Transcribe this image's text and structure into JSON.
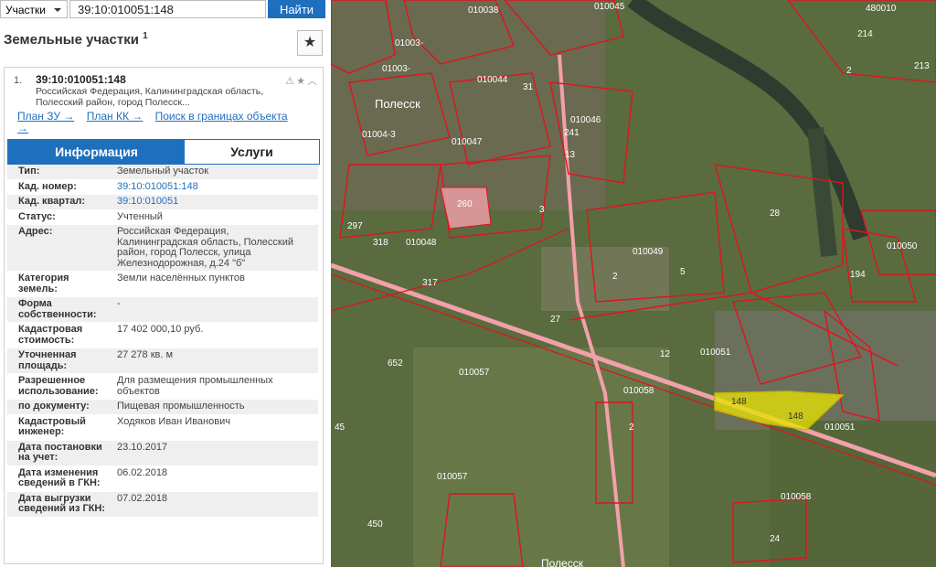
{
  "search": {
    "type_label": "Участки",
    "query": "39:10:010051:148",
    "button_label": "Найти"
  },
  "panel": {
    "title": "Земельные участки",
    "title_sup": "1"
  },
  "card": {
    "index": "1.",
    "cad_number": "39:10:010051:148",
    "address_short": "Российская Федерация, Калининградская область, Полесский район, город Полесск...",
    "links": [
      "План ЗУ →",
      "План КК →",
      "Поиск в границах объекта →"
    ],
    "tabs": [
      "Информация",
      "Услуги"
    ],
    "rows": [
      {
        "k": "Тип:",
        "v": "Земельный участок"
      },
      {
        "k": "Кад. номер:",
        "v": "39:10:010051:148"
      },
      {
        "k": "Кад. квартал:",
        "v": "39:10:010051"
      },
      {
        "k": "Статус:",
        "v": "Учтенный"
      },
      {
        "k": "Адрес:",
        "v": "Российская Федерация, Калининградская область, Полесский район, город Полесск, улица Железнодорожная, д.24 \"б\""
      },
      {
        "k": "Категория земель:",
        "v": "Земли населённых пунктов"
      },
      {
        "k": "Форма собственности:",
        "v": "-"
      },
      {
        "k": "Кадастровая стоимость:",
        "v": "17 402 000,10 руб."
      },
      {
        "k": "Уточненная площадь:",
        "v": "27 278 кв. м"
      },
      {
        "k": "Разрешенное использование:",
        "v": "Для размещения промышленных объектов"
      },
      {
        "k": "по документу:",
        "v": "Пищевая промышленность"
      },
      {
        "k": "Кадастровый инженер:",
        "v": "Ходяков Иван Иванович"
      },
      {
        "k": "Дата постановки на учет:",
        "v": "23.10.2017"
      },
      {
        "k": "Дата изменения сведений в ГКН:",
        "v": "06.02.2018"
      },
      {
        "k": "Дата выгрузки сведений из ГКН:",
        "v": "07.02.2018"
      }
    ]
  },
  "map": {
    "labels": [
      "010038",
      "010045",
      "480010",
      "214",
      "213",
      "2",
      "01003-",
      "01003-",
      "010044",
      "31",
      "010046",
      "241",
      "Полесск",
      "01004-3",
      "010047",
      "13",
      "260",
      "28",
      "297",
      "318",
      "010048",
      "3",
      "010049",
      "2",
      "5",
      "194",
      "010050",
      "317",
      "27",
      "12",
      "010051",
      "148",
      "148",
      "010051",
      "010057",
      "652",
      "010058",
      "45",
      "2",
      "010057",
      "010058",
      "24",
      "450",
      "Полесск"
    ],
    "colors": {
      "boundary": "#e0141e",
      "selected": "#e8e400",
      "road": "#f2a0aa"
    }
  }
}
